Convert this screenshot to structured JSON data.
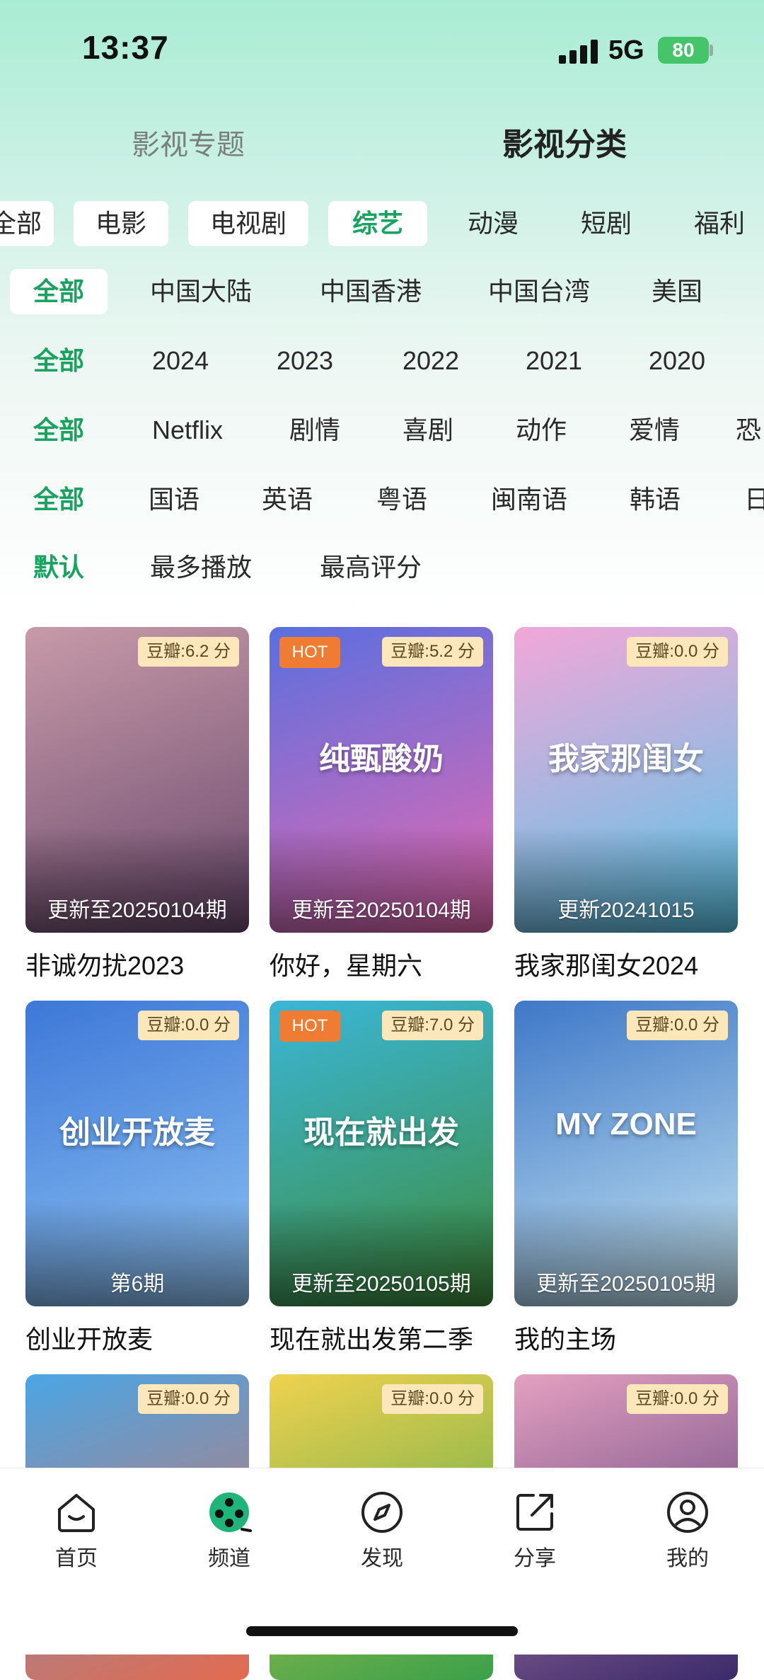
{
  "status_bar": {
    "time": "13:37",
    "network": "5G",
    "battery": "80"
  },
  "top_tabs": [
    {
      "label": "影视专题",
      "active": false
    },
    {
      "label": "影视分类",
      "active": true
    }
  ],
  "filters": {
    "type": {
      "items": [
        "全部",
        "电影",
        "电视剧",
        "综艺",
        "动漫",
        "短剧",
        "福利"
      ],
      "active": "综艺"
    },
    "region": {
      "items": [
        "全部",
        "中国大陆",
        "中国香港",
        "中国台湾",
        "美国"
      ],
      "active": "全部"
    },
    "year": {
      "items": [
        "全部",
        "2024",
        "2023",
        "2022",
        "2021",
        "2020"
      ],
      "active": "全部"
    },
    "genre": {
      "items": [
        "全部",
        "Netflix",
        "剧情",
        "喜剧",
        "动作",
        "爱情",
        "恐"
      ],
      "active": "全部"
    },
    "language": {
      "items": [
        "全部",
        "国语",
        "英语",
        "粤语",
        "闽南语",
        "韩语",
        "日"
      ],
      "active": "全部"
    },
    "sort": {
      "items": [
        "默认",
        "最多播放",
        "最高评分"
      ],
      "active": "默认"
    }
  },
  "cards": [
    {
      "title": "非诚勿扰2023",
      "score": "豆瓣:6.2 分",
      "hot": "",
      "update": "更新至20250104期",
      "colors": [
        "#c79aa8",
        "#6b4a6e"
      ]
    },
    {
      "title": "你好，星期六",
      "score": "豆瓣:5.2 分",
      "hot": "HOT",
      "update": "更新至20250104期",
      "colors": [
        "#5a6fe0",
        "#e86ab0"
      ]
    },
    {
      "title": "我家那闺女2024",
      "score": "豆瓣:0.0 分",
      "hot": "",
      "update": "更新20241015",
      "colors": [
        "#f2a7d8",
        "#58c6e8"
      ]
    },
    {
      "title": "创业开放麦",
      "score": "豆瓣:0.0 分",
      "hot": "",
      "update": "第6期",
      "colors": [
        "#3d78d8",
        "#8fc3f2"
      ]
    },
    {
      "title": "现在就出发第二季",
      "score": "豆瓣:7.0 分",
      "hot": "HOT",
      "update": "更新至20250105期",
      "colors": [
        "#3ab6d8",
        "#3e8c3a"
      ]
    },
    {
      "title": "我的主场",
      "score": "豆瓣:0.0 分",
      "hot": "",
      "update": "更新至20250105期",
      "colors": [
        "#3f78c8",
        "#c6e6f2"
      ]
    },
    {
      "title": "",
      "score": "豆瓣:0.0 分",
      "hot": "",
      "update": "",
      "colors": [
        "#4aa6e6",
        "#e56a4e"
      ]
    },
    {
      "title": "",
      "score": "豆瓣:0.0 分",
      "hot": "",
      "update": "",
      "colors": [
        "#f0d24e",
        "#3aa04a"
      ]
    },
    {
      "title": "",
      "score": "豆瓣:0.0 分",
      "hot": "",
      "update": "",
      "colors": [
        "#e4a0c0",
        "#3a2a6a"
      ]
    }
  ],
  "poster_art": [
    "",
    "纯甄酸奶",
    "我家那闺女",
    "创业开放麦",
    "现在就出发",
    "MY ZONE",
    "",
    "",
    ""
  ],
  "bottom_nav": [
    {
      "label": "首页",
      "icon": "home-icon"
    },
    {
      "label": "频道",
      "icon": "channel-icon"
    },
    {
      "label": "发现",
      "icon": "compass-icon"
    },
    {
      "label": "分享",
      "icon": "share-icon"
    },
    {
      "label": "我的",
      "icon": "profile-icon"
    }
  ],
  "theme": {
    "accent": "#1aa260",
    "hot": "#f07b32",
    "score_bg": "#fbe7b9"
  }
}
